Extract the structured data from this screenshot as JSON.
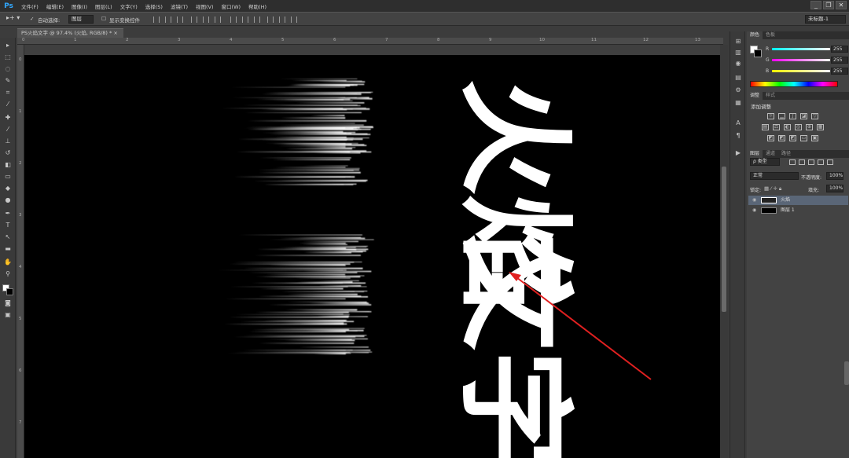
{
  "app": {
    "logo": "Ps"
  },
  "menu": [
    "文件(F)",
    "编辑(E)",
    "图像(I)",
    "图层(L)",
    "文字(Y)",
    "选择(S)",
    "滤镜(T)",
    "视图(V)",
    "窗口(W)",
    "帮助(H)"
  ],
  "window_controls": [
    "_",
    "❐",
    "✕"
  ],
  "options": {
    "auto_select_label": "自动选择:",
    "auto_select_value": "图层",
    "show_transform_label": "显示变换控件",
    "workspace": "未标题-1"
  },
  "document_tab": {
    "title": "PS火焰文字 @ 97.4% (火焰, RGB/8) * ×"
  },
  "ruler_top": [
    "0",
    "1",
    "2",
    "3",
    "4",
    "5",
    "6",
    "7",
    "8",
    "9",
    "10",
    "11",
    "12",
    "13",
    "14",
    "15"
  ],
  "ruler_left": [
    "0",
    "1",
    "2",
    "3",
    "4",
    "5",
    "6",
    "7"
  ],
  "canvas_text": {
    "line1": "火焰",
    "line2": "文字"
  },
  "panels": {
    "color": {
      "tabs": [
        "颜色",
        "色板"
      ],
      "channels": [
        {
          "label": "R",
          "value": "255"
        },
        {
          "label": "G",
          "value": "255"
        },
        {
          "label": "B",
          "value": "255"
        }
      ]
    },
    "adjustments": {
      "tabs": [
        "调整",
        "样式"
      ],
      "title": "添加调整"
    },
    "layers": {
      "tabs": [
        "图层",
        "通道",
        "路径"
      ],
      "filter_label": "ρ 类型",
      "blend_mode": "正常",
      "opacity_label": "不透明度:",
      "opacity_value": "100%",
      "lock_label": "锁定:",
      "fill_label": "填充:",
      "fill_value": "100%",
      "items": [
        {
          "name": "火焰",
          "selected": true
        },
        {
          "name": "图层 1",
          "selected": false
        }
      ]
    }
  },
  "colors": {
    "arrow": "#e02020",
    "canvas": "#000000",
    "text": "#ffffff"
  }
}
